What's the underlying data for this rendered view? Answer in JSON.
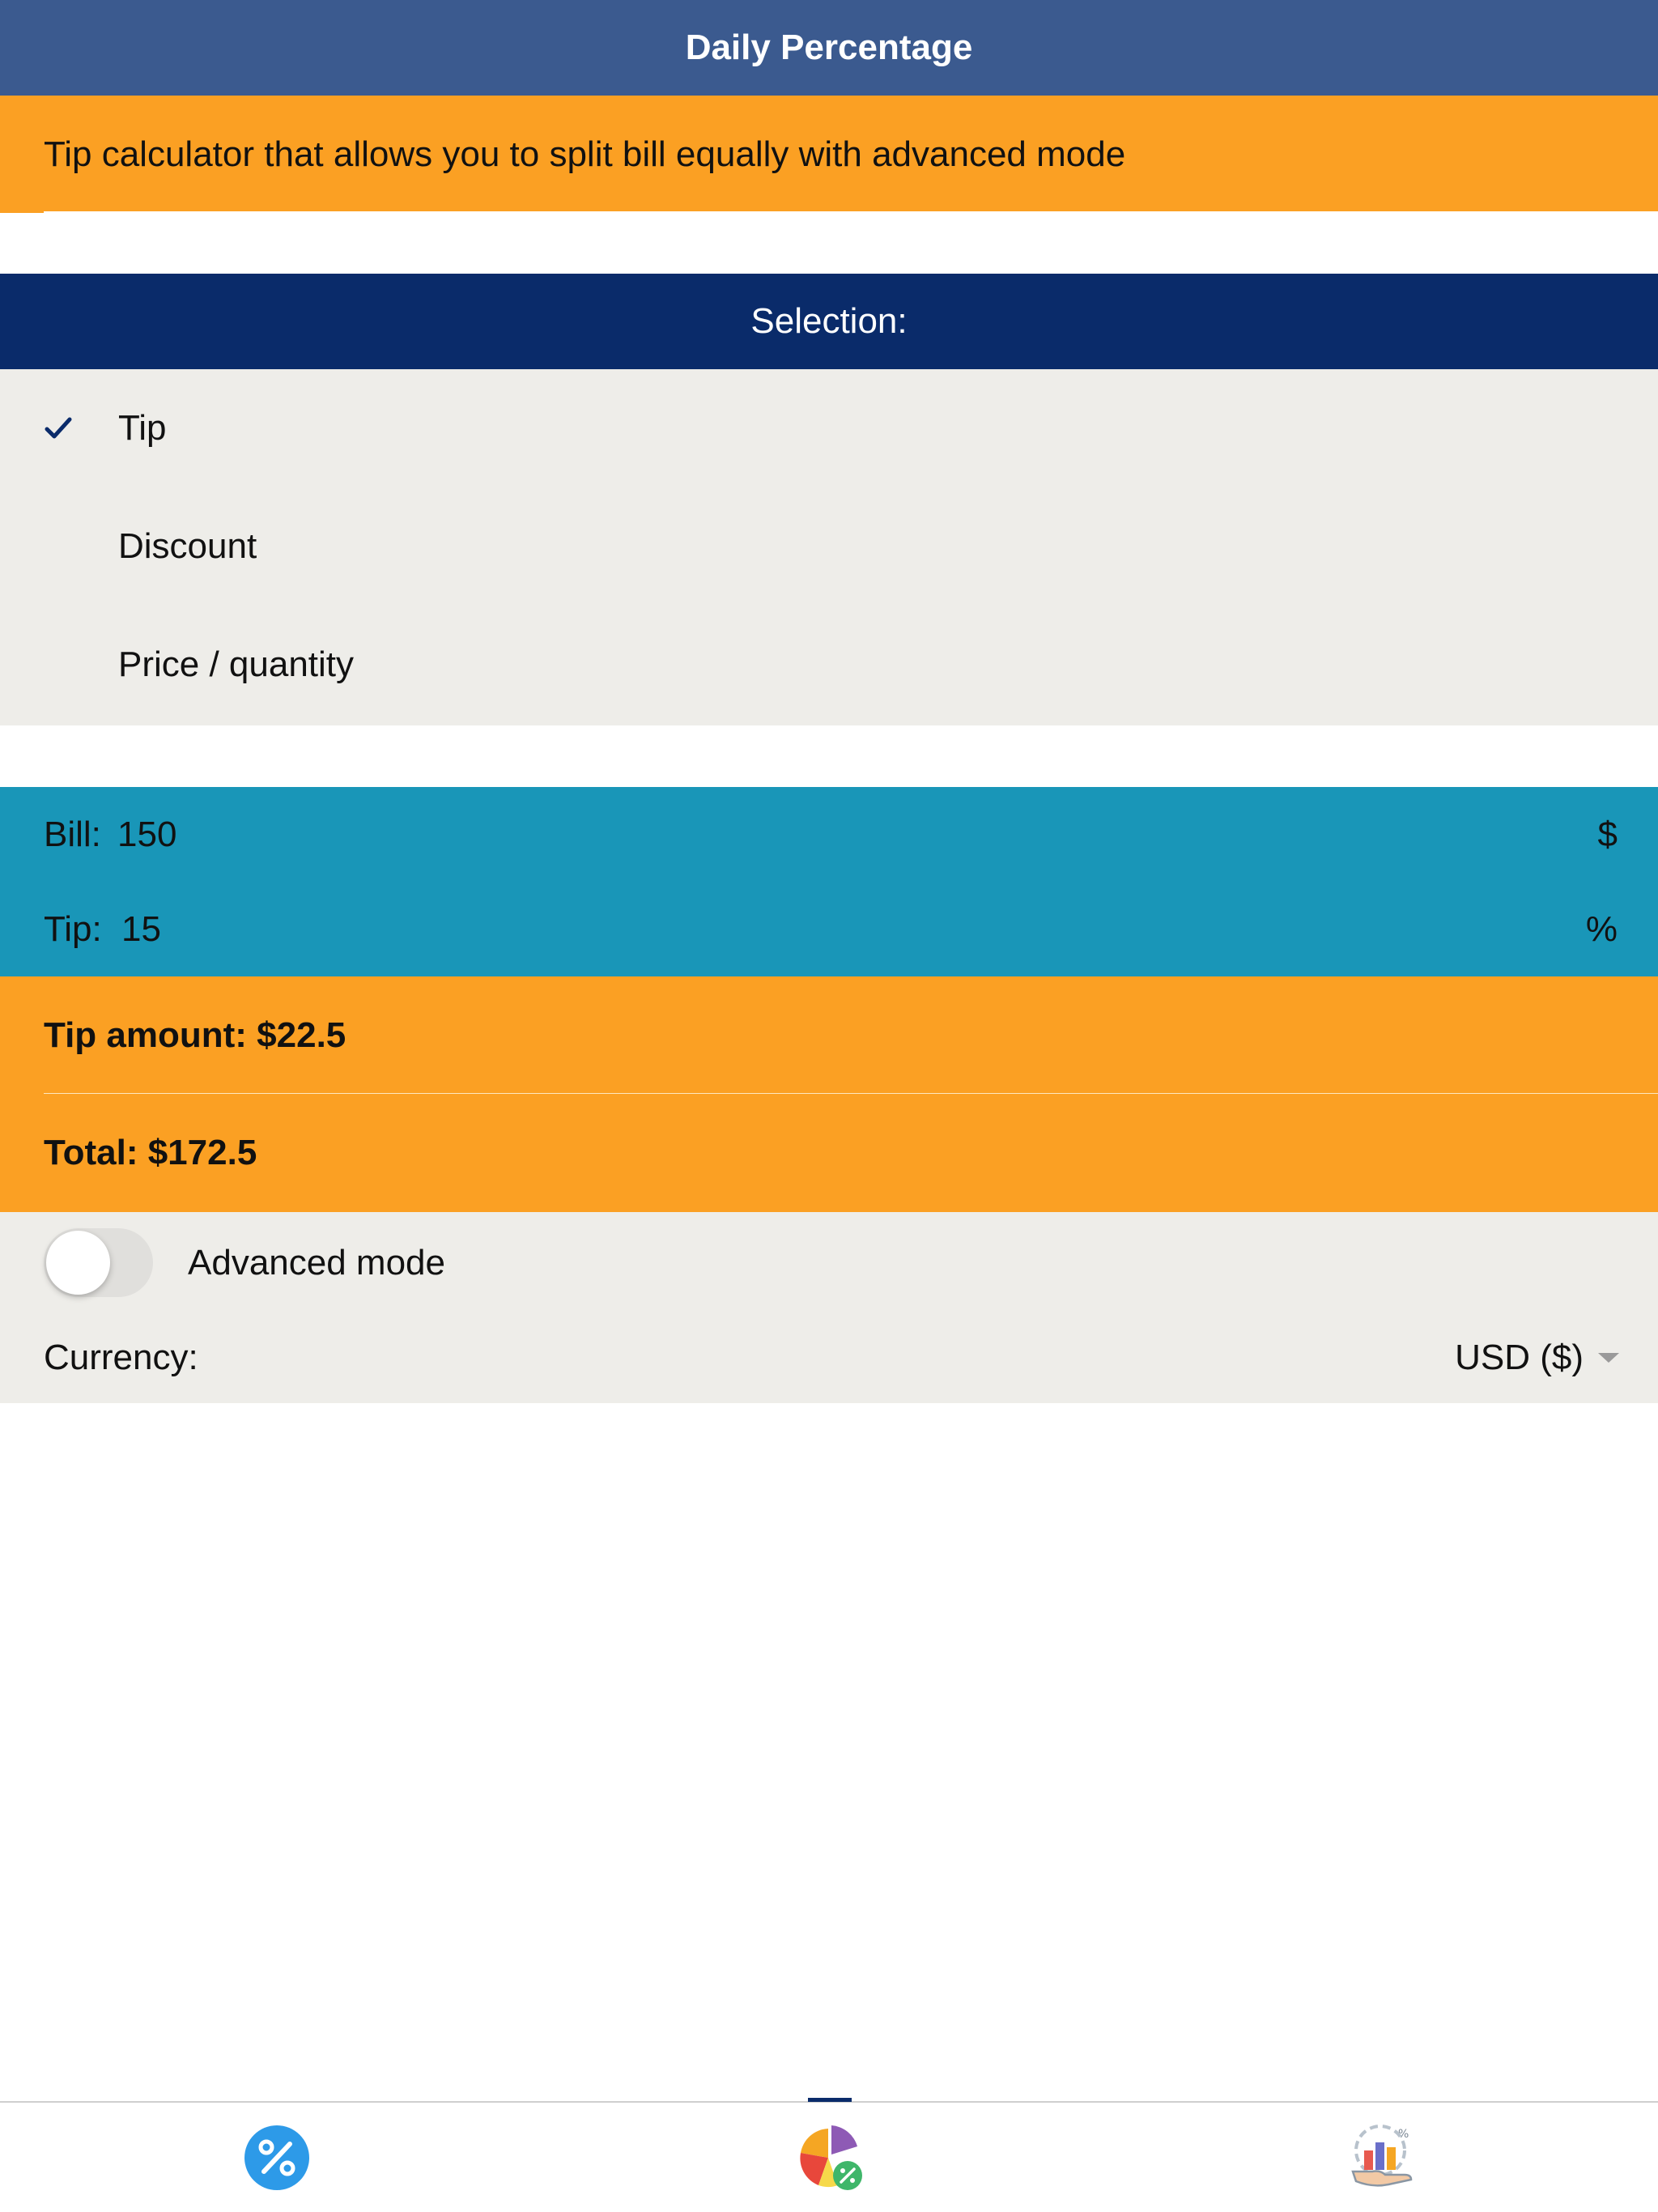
{
  "header": {
    "title": "Daily Percentage"
  },
  "description": "Tip calculator that allows you to split bill equally with advanced mode",
  "selection": {
    "title": "Selection:",
    "options": [
      {
        "label": "Tip",
        "selected": true
      },
      {
        "label": "Discount",
        "selected": false
      },
      {
        "label": "Price / quantity",
        "selected": false
      }
    ]
  },
  "inputs": {
    "bill": {
      "label": "Bill:",
      "value": "150",
      "unit": "$"
    },
    "tip": {
      "label": "Tip:",
      "value": "15",
      "unit": "%"
    }
  },
  "results": {
    "tip_amount": "Tip amount: $22.5",
    "total": "Total: $172.5"
  },
  "settings": {
    "advanced_mode": {
      "label": "Advanced mode",
      "enabled": false
    },
    "currency": {
      "label": "Currency:",
      "value": "USD ($)"
    }
  },
  "tabs": [
    {
      "icon": "percent-icon",
      "active": false
    },
    {
      "icon": "pie-chart-icon",
      "active": true
    },
    {
      "icon": "finance-chart-icon",
      "active": false
    }
  ],
  "colors": {
    "title_bar": "#3b5a8f",
    "accent_orange": "#fba023",
    "navy": "#0a2b6a",
    "teal": "#1996b8",
    "panel_gray": "#eeede9"
  }
}
